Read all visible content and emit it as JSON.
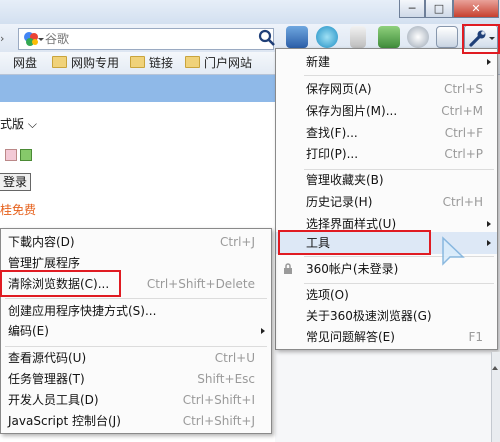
{
  "search": {
    "placeholder": "谷歌"
  },
  "bookmarks": [
    "网盘",
    "网购专用",
    "链接",
    "门户网站"
  ],
  "page": {
    "style_dropdown": "式版",
    "login_button": "登录",
    "promo_text": "桂免费"
  },
  "tools_menu": {
    "items": [
      {
        "label": "新建",
        "shortcut": ""
      },
      {
        "label": "保存网页(A)",
        "shortcut": "Ctrl+S"
      },
      {
        "label": "保存为图片(M)...",
        "shortcut": "Ctrl+M"
      },
      {
        "label": "查找(F)...",
        "shortcut": "Ctrl+F"
      },
      {
        "label": "打印(P)...",
        "shortcut": "Ctrl+P"
      },
      {
        "label": "管理收藏夹(B)",
        "shortcut": ""
      },
      {
        "label": "历史记录(H)",
        "shortcut": "Ctrl+H"
      },
      {
        "label": "选择界面样式(U)",
        "shortcut": ""
      },
      {
        "label": "工具",
        "shortcut": ""
      },
      {
        "label": "360帐户(未登录)",
        "shortcut": ""
      },
      {
        "label": "选项(O)",
        "shortcut": ""
      },
      {
        "label": "关于360极速浏览器(G)",
        "shortcut": ""
      },
      {
        "label": "常见问题解答(E)",
        "shortcut": "F1"
      }
    ]
  },
  "tools_submenu": {
    "items": [
      {
        "label": "下載内容(D)",
        "shortcut": "Ctrl+J"
      },
      {
        "label": "管理扩展程序",
        "shortcut": ""
      },
      {
        "label": "清除浏览数据(C)...",
        "shortcut": "Ctrl+Shift+Delete"
      },
      {
        "label": "创建应用程序快捷方式(S)...",
        "shortcut": ""
      },
      {
        "label": "编码(E)",
        "shortcut": ""
      },
      {
        "label": "查看源代码(U)",
        "shortcut": "Ctrl+U"
      },
      {
        "label": "任务管理器(T)",
        "shortcut": "Shift+Esc"
      },
      {
        "label": "开发人员工具(D)",
        "shortcut": "Ctrl+Shift+I"
      },
      {
        "label": "JavaScript 控制台(J)",
        "shortcut": "Ctrl+Shift+J"
      }
    ]
  },
  "colors": {
    "highlight": "#e01b22",
    "page_band": "#8fb9e8",
    "hover_row": "#dde8f6"
  }
}
